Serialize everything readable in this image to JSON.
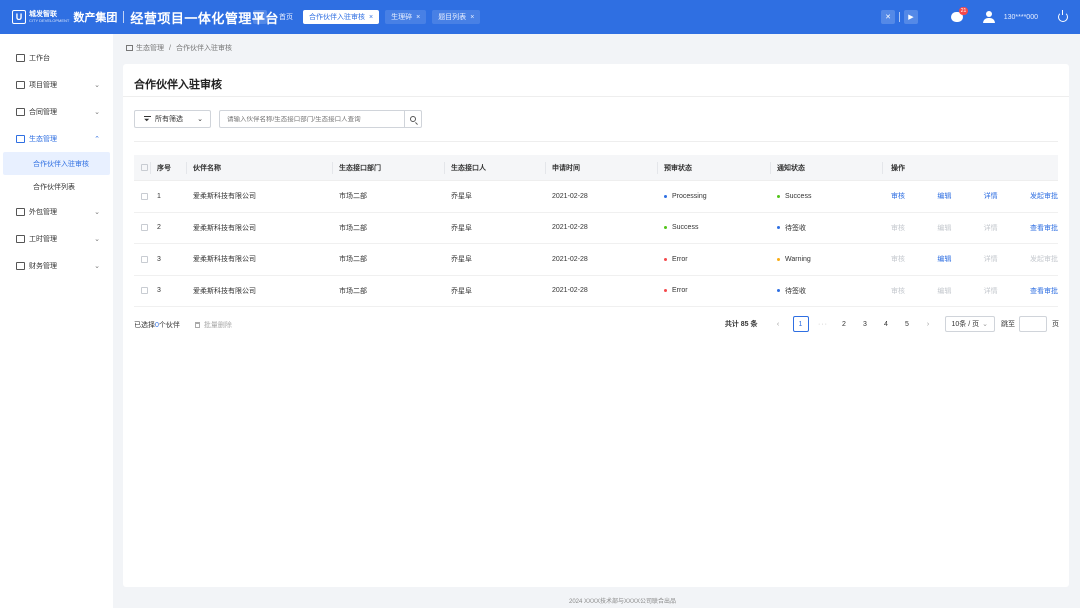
{
  "header": {
    "logo_mark": "U",
    "logo_name": "城发智联",
    "logo_sub": "CITY DEVELOPMENT",
    "group_name": "数产集团",
    "platform_title": "经营项目一体化管理平台",
    "home_tab": "首页",
    "tabs": [
      {
        "label": "合作伙伴入驻审核",
        "active": true
      },
      {
        "label": "生理碎",
        "active": false
      },
      {
        "label": "题目列表",
        "active": false
      }
    ],
    "close_symbol": "×",
    "message_count": "21",
    "username": "130****000"
  },
  "sidebar": {
    "items": [
      {
        "label": "工作台",
        "has_children": false
      },
      {
        "label": "项目管理",
        "has_children": true
      },
      {
        "label": "合同管理",
        "has_children": true
      },
      {
        "label": "生态管理",
        "has_children": true,
        "open": true
      },
      {
        "label": "外包管理",
        "has_children": true
      },
      {
        "label": "工时管理",
        "has_children": true
      },
      {
        "label": "财务管理",
        "has_children": true
      }
    ],
    "sub_items": [
      {
        "label": "合作伙伴入驻审核",
        "active": true
      },
      {
        "label": "合作伙伴列表",
        "active": false
      }
    ]
  },
  "breadcrumb": {
    "level1": "生态管理",
    "separator": "/",
    "level2": "合作伙伴入驻审核"
  },
  "page": {
    "title": "合作伙伴入驻审核",
    "filter_label": "所有筛选",
    "search_placeholder": "请输入伙伴名称/生态接口部门/生态接口人查询"
  },
  "table": {
    "columns": [
      "序号",
      "伙伴名称",
      "生态接口部门",
      "生态接口人",
      "申请时间",
      "预审状态",
      "通知状态",
      "操作"
    ],
    "rows": [
      {
        "no": "1",
        "name": "爱柔斯科技有限公司",
        "dept": "市场二部",
        "contact": "乔星阜",
        "date": "2021-02-28",
        "pre_status": "Processing",
        "pre_color": "#2f6fe2",
        "notice_status": "Success",
        "notice_color": "#52c41a",
        "ops": [
          {
            "label": "审核",
            "enabled": true
          },
          {
            "label": "编辑",
            "enabled": true
          },
          {
            "label": "详情",
            "enabled": true
          },
          {
            "label": "发起审批",
            "enabled": true
          }
        ]
      },
      {
        "no": "2",
        "name": "爱柔斯科技有限公司",
        "dept": "市场二部",
        "contact": "乔星阜",
        "date": "2021-02-28",
        "pre_status": "Success",
        "pre_color": "#52c41a",
        "notice_status": "待签收",
        "notice_color": "#2f6fe2",
        "ops": [
          {
            "label": "审核",
            "enabled": false
          },
          {
            "label": "编辑",
            "enabled": false
          },
          {
            "label": "详情",
            "enabled": false
          },
          {
            "label": "查看审批",
            "enabled": true
          }
        ]
      },
      {
        "no": "3",
        "name": "爱柔斯科技有限公司",
        "dept": "市场二部",
        "contact": "乔星阜",
        "date": "2021-02-28",
        "pre_status": "Error",
        "pre_color": "#f5494b",
        "notice_status": "Warning",
        "notice_color": "#faad14",
        "ops": [
          {
            "label": "审核",
            "enabled": false
          },
          {
            "label": "编辑",
            "enabled": true
          },
          {
            "label": "详情",
            "enabled": false
          },
          {
            "label": "发起审批",
            "enabled": false
          }
        ]
      },
      {
        "no": "3",
        "name": "爱柔斯科技有限公司",
        "dept": "市场二部",
        "contact": "乔星阜",
        "date": "2021-02-28",
        "pre_status": "Error",
        "pre_color": "#f5494b",
        "notice_status": "待签收",
        "notice_color": "#2f6fe2",
        "ops": [
          {
            "label": "审核",
            "enabled": false
          },
          {
            "label": "编辑",
            "enabled": false
          },
          {
            "label": "详情",
            "enabled": false
          },
          {
            "label": "查看审批",
            "enabled": true
          }
        ]
      }
    ]
  },
  "footer": {
    "selected_prefix": "已选择",
    "selected_count": "0",
    "selected_suffix": "个伙伴",
    "batch_delete": "批量删除",
    "total_text": "共计 85 条",
    "pages": [
      "1",
      "2",
      "3",
      "4",
      "5"
    ],
    "current_page": "1",
    "prev": "‹",
    "next": "›",
    "ellipsis": "···",
    "page_size": "10条 / 页",
    "goto_label": "跳至",
    "goto_suffix": "页"
  },
  "copyright": "2024 XXXX技术部与XXXX公司联合出品"
}
